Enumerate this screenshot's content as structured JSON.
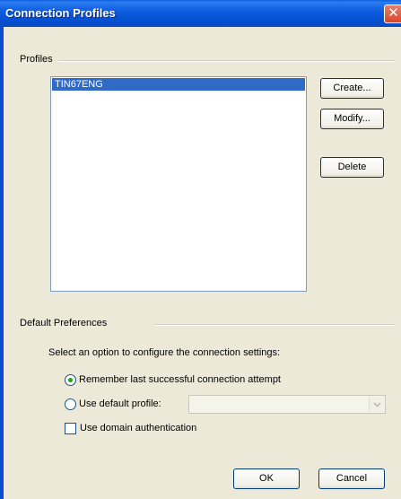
{
  "window": {
    "title": "Connection Profiles",
    "close_glyph": "✕"
  },
  "profiles": {
    "group_label": "Profiles",
    "items": [
      "TIN67ENG"
    ],
    "buttons": {
      "create": "Create...",
      "modify": "Modify...",
      "delete": "Delete"
    }
  },
  "preferences": {
    "group_label": "Default Preferences",
    "instruction": "Select an option to configure the connection settings:",
    "remember_label": "Remember last successful connection attempt",
    "default_profile_label": "Use default profile:",
    "default_profile_value": "",
    "domain_auth_label": "Use domain authentication",
    "selected_option": "remember",
    "domain_auth_checked": false
  },
  "dialog_buttons": {
    "ok": "OK",
    "cancel": "Cancel"
  },
  "colors": {
    "title_bar": "#0a5fe0",
    "selection": "#316ac5",
    "radio_dot": "#21a121"
  },
  "icons": {
    "close": "close-icon",
    "dropdown": "chevron-down-icon"
  }
}
